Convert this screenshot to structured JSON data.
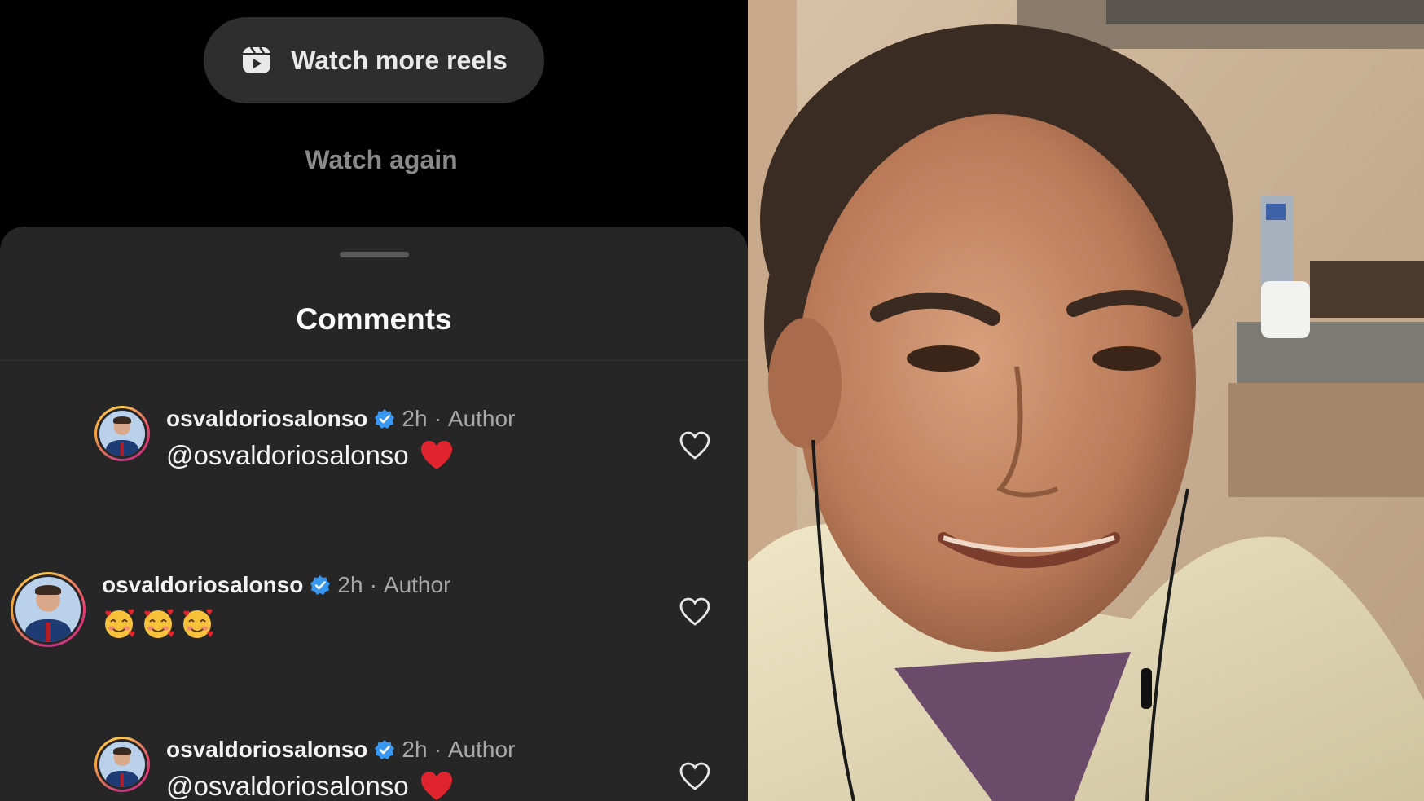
{
  "watch_more_label": "Watch more reels",
  "watch_again_label": "Watch again",
  "comments_title": "Comments",
  "comments": [
    {
      "username": "osvaldoriosalonso",
      "time": "2h",
      "separator": "·",
      "badge": "Author",
      "text": "@osvaldoriosalonso",
      "trailing_emoji": "red-heart"
    },
    {
      "username": "osvaldoriosalonso",
      "time": "2h",
      "separator": "·",
      "badge": "Author",
      "text": "",
      "emojis": [
        "smiling-face-with-hearts",
        "smiling-face-with-hearts",
        "smiling-face-with-hearts"
      ]
    },
    {
      "username": "osvaldoriosalonso",
      "time": "2h",
      "separator": "·",
      "badge": "Author",
      "text": "@osvaldoriosalonso",
      "trailing_emoji": "red-heart"
    }
  ],
  "colors": {
    "verified": "#3897f0",
    "heart": "#e0242e",
    "sheet_bg": "#262626"
  },
  "icons": [
    "reels-icon",
    "verified-badge-icon",
    "like-heart-icon",
    "red-heart-emoji",
    "smiling-face-with-hearts-emoji"
  ]
}
